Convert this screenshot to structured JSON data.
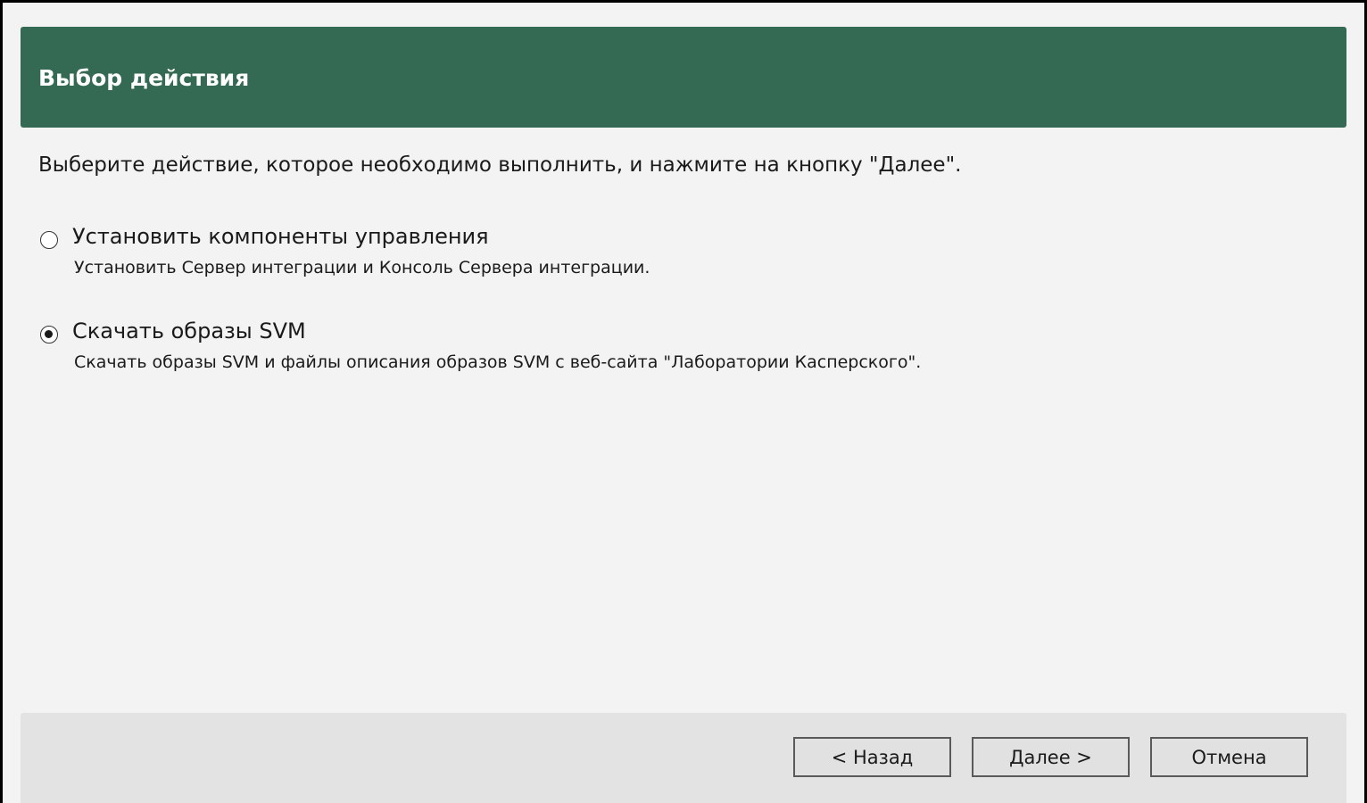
{
  "header": {
    "title": "Выбор действия",
    "background_color": "#346a53"
  },
  "instruction": "Выберите действие, которое необходимо выполнить, и нажмите на кнопку \"Далее\".",
  "options": [
    {
      "label": "Установить компоненты управления",
      "description": "Установить Сервер интеграции и Консоль Сервера интеграции.",
      "selected": false
    },
    {
      "label": "Скачать образы SVM",
      "description": "Скачать образы SVM и файлы описания образов SVM с веб-сайта \"Лаборатории Касперского\".",
      "selected": true
    }
  ],
  "footer": {
    "back_label": "< Назад",
    "next_label": "Далее >",
    "cancel_label": "Отмена"
  }
}
